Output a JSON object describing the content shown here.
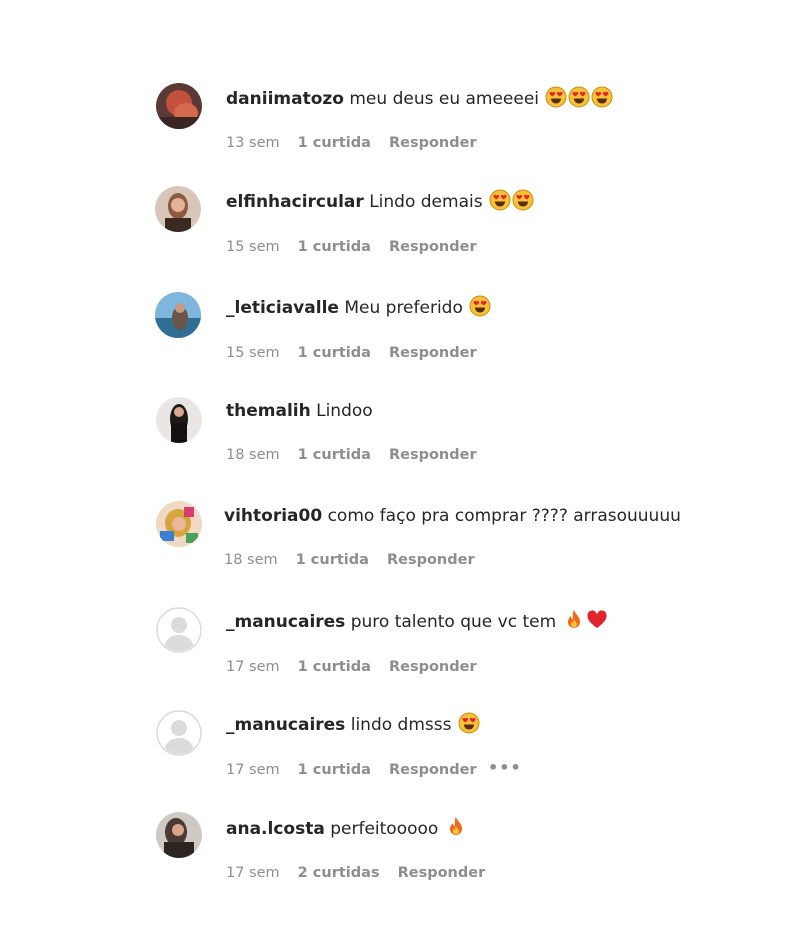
{
  "comments": [
    {
      "user": "daniimatozo",
      "text": "meu deus eu ameeeei",
      "emojis": [
        "heart-eyes",
        "heart-eyes",
        "heart-eyes"
      ],
      "time": "13 sem",
      "likes": "1 curtida",
      "reply": "Responder",
      "avatar": "photo-red-hair"
    },
    {
      "user": "elfinhacircular",
      "text": "Lindo demais",
      "emojis": [
        "heart-eyes",
        "heart-eyes"
      ],
      "time": "15 sem",
      "likes": "1 curtida",
      "reply": "Responder",
      "avatar": "photo-portrait"
    },
    {
      "user": "_leticiavalle",
      "text": "Meu preferido",
      "emojis": [
        "heart-eyes"
      ],
      "time": "15 sem",
      "likes": "1 curtida",
      "reply": "Responder",
      "avatar": "photo-beach"
    },
    {
      "user": "themalih",
      "text": "Lindoo",
      "emojis": [],
      "time": "18 sem",
      "likes": "1 curtida",
      "reply": "Responder",
      "avatar": "photo-dark-hair"
    },
    {
      "user": "vihtoria00",
      "text": "como faço pra comprar ???? arrasouuuuu",
      "emojis": [],
      "time": "18 sem",
      "likes": "1 curtida",
      "reply": "Responder",
      "avatar": "photo-colorful"
    },
    {
      "user": "_manucaires",
      "text": "puro talento que vc tem",
      "emojis": [
        "fire",
        "red-heart"
      ],
      "time": "17 sem",
      "likes": "1 curtida",
      "reply": "Responder",
      "avatar": "default-avatar"
    },
    {
      "user": "_manucaires",
      "text": "lindo dmsss",
      "emojis": [
        "heart-eyes"
      ],
      "time": "17 sem",
      "likes": "1 curtida",
      "reply": "Responder",
      "avatar": "default-avatar",
      "more": "•••"
    },
    {
      "user": "ana.lcosta",
      "text": "perfeitooooo",
      "emojis": [
        "fire"
      ],
      "time": "17 sem",
      "likes": "2 curtidas",
      "reply": "Responder",
      "avatar": "photo-portrait-2"
    }
  ],
  "colors": {
    "text": "#262626",
    "meta": "#8e8e8e",
    "background": "#ffffff"
  }
}
